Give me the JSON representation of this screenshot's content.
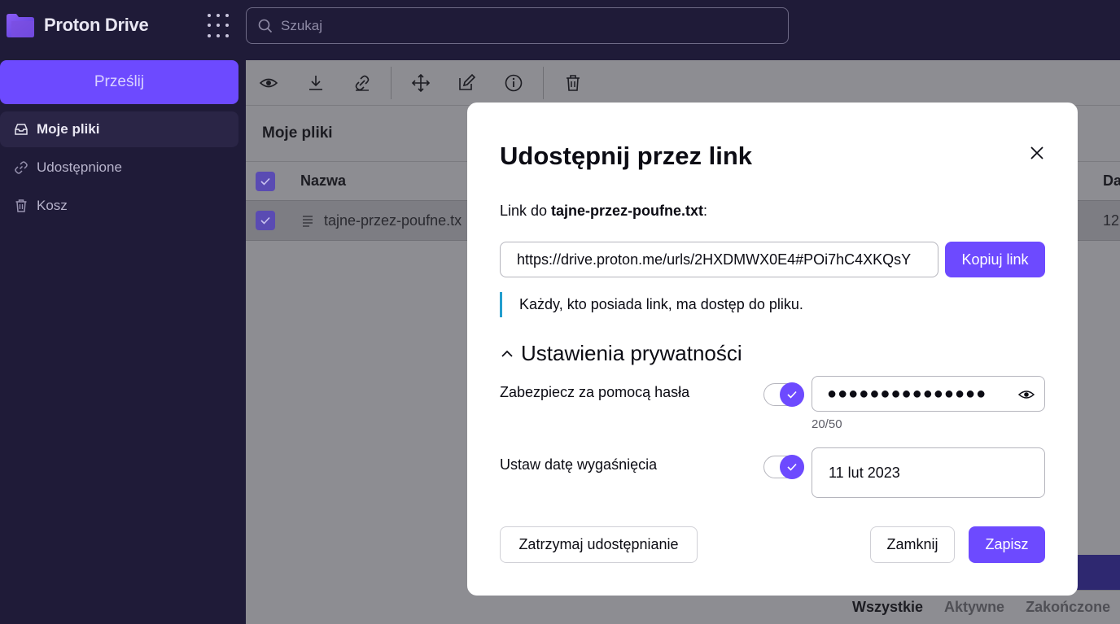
{
  "app": {
    "name": "Proton Drive"
  },
  "search": {
    "placeholder": "Szukaj"
  },
  "sidebar": {
    "upload_label": "Prześlij",
    "items": [
      {
        "label": "Moje pliki",
        "icon": "inbox-icon",
        "active": true
      },
      {
        "label": "Udostępnione",
        "icon": "link-icon",
        "active": false
      },
      {
        "label": "Kosz",
        "icon": "trash-icon",
        "active": false
      }
    ]
  },
  "main": {
    "section_title": "Moje pliki",
    "columns": {
      "name": "Nazwa",
      "date_partial": "Da"
    },
    "rows": [
      {
        "name": "tajne-przez-poufne.tx",
        "date_partial": "12",
        "selected": true
      }
    ],
    "bottom_tabs": [
      "Wszystkie",
      "Aktywne",
      "Zakończone"
    ]
  },
  "modal": {
    "title": "Udostępnij przez link",
    "link_prefix": "Link do ",
    "file_name": "tajne-przez-poufne.txt",
    "link_suffix": ":",
    "url": "https://drive.proton.me/urls/2HXDMWX0E4#POi7hC4XKQsY",
    "copy_label": "Kopiuj link",
    "notice": "Każdy, kto posiada link, ma dostęp do pliku.",
    "privacy_title": "Ustawienia prywatności",
    "password": {
      "label": "Zabezpiecz za pomocą hasła",
      "enabled": true,
      "masked_value": "●●●●●●●●●●●●●●●",
      "counter": "20/50"
    },
    "expiry": {
      "label": "Ustaw datę wygaśnięcia",
      "enabled": true,
      "value": "11 lut 2023"
    },
    "stop_sharing_label": "Zatrzymaj udostępnianie",
    "close_label": "Zamknij",
    "save_label": "Zapisz"
  },
  "colors": {
    "accent": "#6d4aff",
    "sidebar_bg": "#1f1b38",
    "info_bar": "#239ece"
  }
}
